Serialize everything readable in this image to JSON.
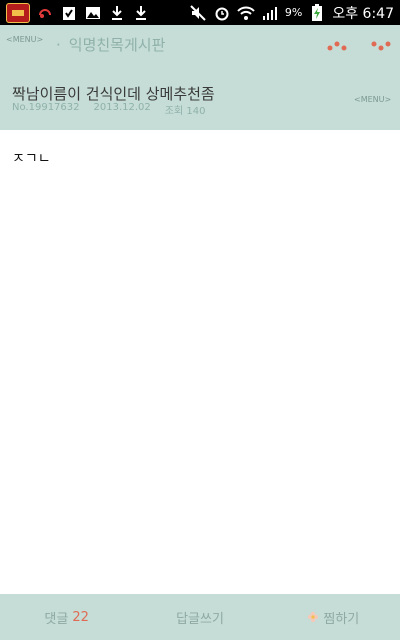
{
  "status_bar": {
    "battery_percent": "9%",
    "time": "오후 6:47"
  },
  "header": {
    "menu_label": "<MENU>",
    "board_title": "익명친목게시판"
  },
  "post": {
    "title": "짝남이름이 건식인데 상메추천좀",
    "number": "No.19917632",
    "date": "2013.12.02",
    "views_label": "조회 140",
    "menu_label": "<MENU>",
    "body": "ㅈㄱㄴ"
  },
  "bottom": {
    "comments_label": "댓글",
    "comments_count": "22",
    "reply_label": "답글쓰기",
    "bookmark_label": "찜하기"
  },
  "colors": {
    "header_bg": "#c5ddd6",
    "accent_muted": "#8fb1aa",
    "count_red": "#e06a54"
  }
}
